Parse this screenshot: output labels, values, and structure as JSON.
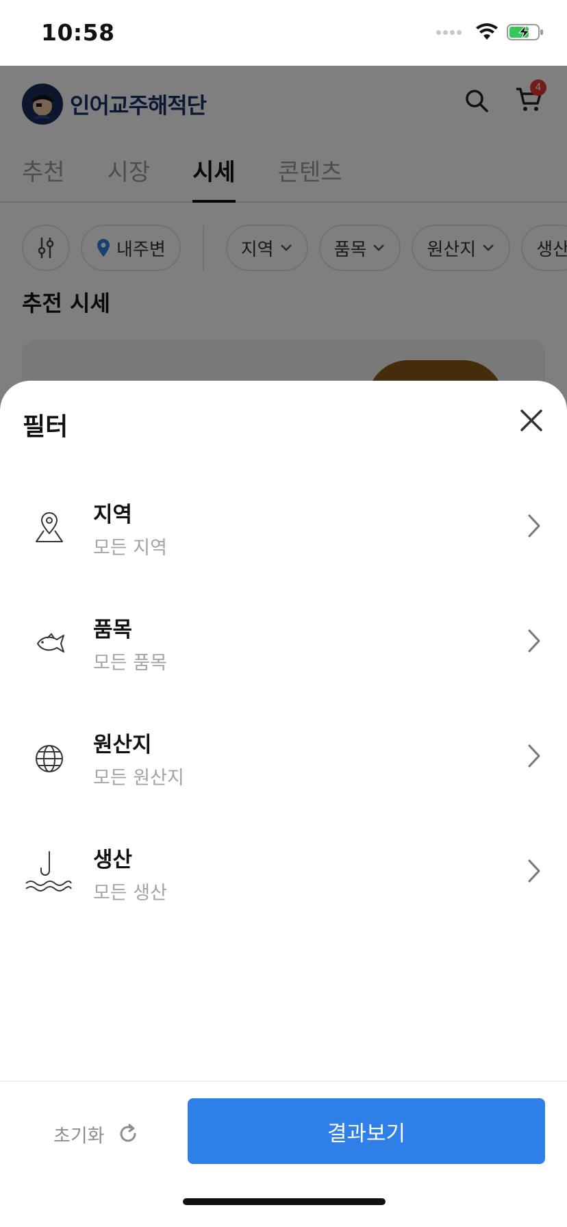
{
  "status_bar": {
    "time": "10:58"
  },
  "header": {
    "brand": "인어교주해적단",
    "cart_count": "4"
  },
  "tabs": [
    {
      "label": "추천"
    },
    {
      "label": "시장"
    },
    {
      "label": "시세",
      "active": true
    },
    {
      "label": "콘텐츠"
    }
  ],
  "chips": {
    "location": "내주변",
    "items": [
      {
        "label": "지역"
      },
      {
        "label": "품목"
      },
      {
        "label": "원산지"
      },
      {
        "label": "생산"
      }
    ]
  },
  "section": {
    "title": "추전 시세"
  },
  "sheet": {
    "title": "필터",
    "filters": [
      {
        "icon": "map-pin-icon",
        "label": "지역",
        "value": "모든 지역"
      },
      {
        "icon": "fish-icon",
        "label": "품목",
        "value": "모든 품목"
      },
      {
        "icon": "globe-icon",
        "label": "원산지",
        "value": "모든 원산지"
      },
      {
        "icon": "fishing-hook-icon",
        "label": "생산",
        "value": "모든 생산"
      }
    ],
    "reset_label": "초기화",
    "submit_label": "결과보기"
  },
  "colors": {
    "primary": "#2f7fe8",
    "badge": "#e53935",
    "brand": "#14316b"
  }
}
